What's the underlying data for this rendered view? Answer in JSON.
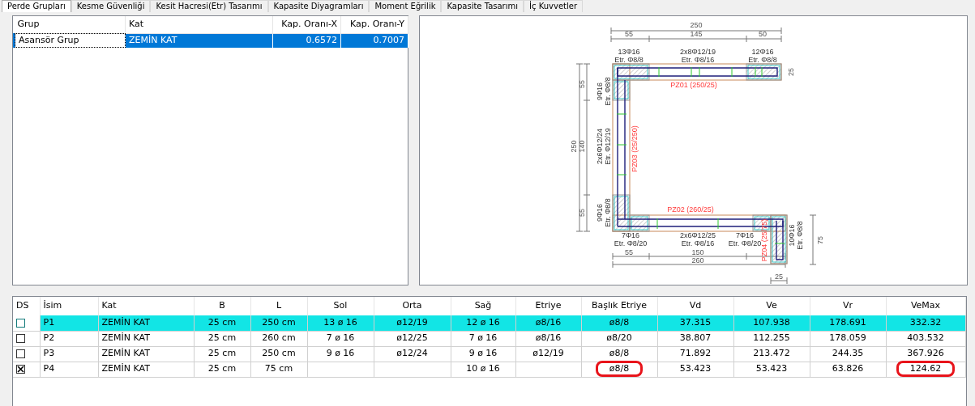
{
  "tabs": [
    {
      "label": "Perde Grupları",
      "selected": true
    },
    {
      "label": "Kesme Güvenliği",
      "selected": false
    },
    {
      "label": "Kesit Hacresi(Etr) Tasarımı",
      "selected": false
    },
    {
      "label": "Kapasite Diyagramları",
      "selected": false
    },
    {
      "label": "Moment Eğrilik",
      "selected": false
    },
    {
      "label": "Kapasite Tasarımı",
      "selected": false
    },
    {
      "label": "İç Kuvvetler",
      "selected": false
    }
  ],
  "group_table": {
    "columns": [
      "Grup",
      "Kat",
      "Kap. Oranı-X",
      "Kap. Oranı-Y"
    ],
    "rows": [
      {
        "selected": true,
        "cells": [
          "Asansör Grup",
          "ZEMİN KAT",
          "0.6572",
          "0.7007"
        ]
      }
    ]
  },
  "section_drawing": {
    "labels": [
      {
        "kind": "dimension",
        "text": "250"
      },
      {
        "kind": "dimension",
        "text": "55"
      },
      {
        "kind": "dimension",
        "text": "145"
      },
      {
        "kind": "dimension",
        "text": "50"
      },
      {
        "kind": "rebar",
        "text": "13Φ16"
      },
      {
        "kind": "rebar",
        "text": "Etr. Φ8/8"
      },
      {
        "kind": "rebar",
        "text": "2x8Φ12/19"
      },
      {
        "kind": "rebar",
        "text": "Etr. Φ8/16"
      },
      {
        "kind": "rebar",
        "text": "12Φ16"
      },
      {
        "kind": "rebar",
        "text": "Etr. Φ8/8"
      },
      {
        "kind": "dimension",
        "text": "25"
      },
      {
        "kind": "wall",
        "text": "PZ01 (250/25)"
      },
      {
        "kind": "dimension",
        "text": "250"
      },
      {
        "kind": "dimension",
        "text": "55"
      },
      {
        "kind": "dimension",
        "text": "140"
      },
      {
        "kind": "dimension",
        "text": "55"
      },
      {
        "kind": "rebar",
        "text": "9Φ16"
      },
      {
        "kind": "rebar",
        "text": "Etr. Φ8/8"
      },
      {
        "kind": "rebar",
        "text": "2x6Φ12/24"
      },
      {
        "kind": "rebar",
        "text": "Etr. Φ12/19"
      },
      {
        "kind": "rebar",
        "text": "9Φ16"
      },
      {
        "kind": "rebar",
        "text": "Etr. Φ8/8"
      },
      {
        "kind": "wall",
        "text": "PZ03 (25/250)"
      },
      {
        "kind": "wall",
        "text": "PZ02 (260/25)"
      },
      {
        "kind": "rebar",
        "text": "7Φ16"
      },
      {
        "kind": "rebar",
        "text": "Etr. Φ8/20"
      },
      {
        "kind": "rebar",
        "text": "2x6Φ12/25"
      },
      {
        "kind": "rebar",
        "text": "Etr. Φ8/16"
      },
      {
        "kind": "rebar",
        "text": "7Φ16"
      },
      {
        "kind": "rebar",
        "text": "Etr. Φ8/20"
      },
      {
        "kind": "dimension",
        "text": "55"
      },
      {
        "kind": "dimension",
        "text": "150"
      },
      {
        "kind": "dimension",
        "text": "260"
      },
      {
        "kind": "wall",
        "text": "PZ04 (25/75)"
      },
      {
        "kind": "rebar",
        "text": "10Φ16"
      },
      {
        "kind": "rebar",
        "text": "Etr. Φ8/8"
      },
      {
        "kind": "dimension",
        "text": "75"
      },
      {
        "kind": "dimension",
        "text": "25"
      }
    ]
  },
  "wall_table": {
    "columns": [
      "DS",
      "İsim",
      "Kat",
      "B",
      "L",
      "Sol",
      "Orta",
      "Sağ",
      "Etriye",
      "Başlık Etriye",
      "Vd",
      "Ve",
      "Vr",
      "VeMax"
    ],
    "rows": [
      {
        "selected": true,
        "cells": [
          {
            "kind": "checkbox",
            "checked": false
          },
          {
            "kind": "text",
            "text": "P1",
            "circled": false
          },
          {
            "kind": "text",
            "text": "ZEMİN KAT",
            "circled": false
          },
          {
            "kind": "text",
            "text": "25 cm",
            "circled": false
          },
          {
            "kind": "text",
            "text": "250 cm",
            "circled": false
          },
          {
            "kind": "text",
            "text": "13 ø 16",
            "circled": false
          },
          {
            "kind": "text",
            "text": "ø12/19",
            "circled": false
          },
          {
            "kind": "text",
            "text": "12 ø 16",
            "circled": false
          },
          {
            "kind": "text",
            "text": "ø8/16",
            "circled": false
          },
          {
            "kind": "text",
            "text": "ø8/8",
            "circled": false
          },
          {
            "kind": "text",
            "text": "37.315",
            "circled": false
          },
          {
            "kind": "text",
            "text": "107.938",
            "circled": false
          },
          {
            "kind": "text",
            "text": "178.691",
            "circled": false
          },
          {
            "kind": "text",
            "text": "332.32",
            "circled": false
          }
        ]
      },
      {
        "selected": false,
        "cells": [
          {
            "kind": "checkbox",
            "checked": false
          },
          {
            "kind": "text",
            "text": "P2",
            "circled": false
          },
          {
            "kind": "text",
            "text": "ZEMİN KAT",
            "circled": false
          },
          {
            "kind": "text",
            "text": "25 cm",
            "circled": false
          },
          {
            "kind": "text",
            "text": "260 cm",
            "circled": false
          },
          {
            "kind": "text",
            "text": "7 ø 16",
            "circled": false
          },
          {
            "kind": "text",
            "text": "ø12/25",
            "circled": false
          },
          {
            "kind": "text",
            "text": "7 ø 16",
            "circled": false
          },
          {
            "kind": "text",
            "text": "ø8/16",
            "circled": false
          },
          {
            "kind": "text",
            "text": "ø8/20",
            "circled": false
          },
          {
            "kind": "text",
            "text": "38.807",
            "circled": false
          },
          {
            "kind": "text",
            "text": "112.255",
            "circled": false
          },
          {
            "kind": "text",
            "text": "178.059",
            "circled": false
          },
          {
            "kind": "text",
            "text": "403.532",
            "circled": false
          }
        ]
      },
      {
        "selected": false,
        "cells": [
          {
            "kind": "checkbox",
            "checked": false
          },
          {
            "kind": "text",
            "text": "P3",
            "circled": false
          },
          {
            "kind": "text",
            "text": "ZEMİN KAT",
            "circled": false
          },
          {
            "kind": "text",
            "text": "25 cm",
            "circled": false
          },
          {
            "kind": "text",
            "text": "250 cm",
            "circled": false
          },
          {
            "kind": "text",
            "text": "9 ø 16",
            "circled": false
          },
          {
            "kind": "text",
            "text": "ø12/24",
            "circled": false
          },
          {
            "kind": "text",
            "text": "9 ø 16",
            "circled": false
          },
          {
            "kind": "text",
            "text": "ø12/19",
            "circled": false
          },
          {
            "kind": "text",
            "text": "ø8/8",
            "circled": false
          },
          {
            "kind": "text",
            "text": "71.892",
            "circled": false
          },
          {
            "kind": "text",
            "text": "213.472",
            "circled": false
          },
          {
            "kind": "text",
            "text": "244.35",
            "circled": false
          },
          {
            "kind": "text",
            "text": "367.926",
            "circled": false
          }
        ]
      },
      {
        "selected": false,
        "cells": [
          {
            "kind": "checkbox",
            "checked": true
          },
          {
            "kind": "text",
            "text": "P4",
            "circled": false
          },
          {
            "kind": "text",
            "text": "ZEMİN KAT",
            "circled": false
          },
          {
            "kind": "text",
            "text": "25 cm",
            "circled": false
          },
          {
            "kind": "text",
            "text": "75 cm",
            "circled": false
          },
          {
            "kind": "empty"
          },
          {
            "kind": "empty"
          },
          {
            "kind": "text",
            "text": "10 ø 16",
            "circled": false
          },
          {
            "kind": "empty"
          },
          {
            "kind": "text",
            "text": "ø8/8",
            "circled": true
          },
          {
            "kind": "text",
            "text": "53.423",
            "circled": false
          },
          {
            "kind": "text",
            "text": "53.423",
            "circled": false
          },
          {
            "kind": "text",
            "text": "63.826",
            "circled": false
          },
          {
            "kind": "text",
            "text": "124.62",
            "circled": true
          }
        ]
      }
    ]
  }
}
